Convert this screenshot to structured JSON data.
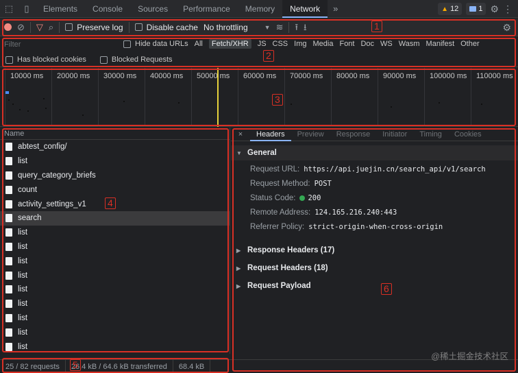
{
  "tabs": {
    "items": [
      {
        "label": "Elements"
      },
      {
        "label": "Console"
      },
      {
        "label": "Sources"
      },
      {
        "label": "Performance"
      },
      {
        "label": "Memory"
      },
      {
        "label": "Network"
      }
    ],
    "more": "»",
    "warnings_count": "12",
    "messages_count": "1"
  },
  "toolbar": {
    "preserve_log": "Preserve log",
    "disable_cache": "Disable cache",
    "throttling": "No throttling"
  },
  "filter": {
    "placeholder": "Filter",
    "hide_data_urls": "Hide data URLs",
    "types": [
      "All",
      "Fetch/XHR",
      "JS",
      "CSS",
      "Img",
      "Media",
      "Font",
      "Doc",
      "WS",
      "Wasm",
      "Manifest",
      "Other"
    ],
    "active_type": "Fetch/XHR",
    "has_blocked_cookies": "Has blocked cookies",
    "blocked_requests": "Blocked Requests"
  },
  "overview": {
    "ticks": [
      "10000 ms",
      "20000 ms",
      "30000 ms",
      "40000 ms",
      "50000 ms",
      "60000 ms",
      "70000 ms",
      "80000 ms",
      "90000 ms",
      "100000 ms",
      "110000 ms"
    ]
  },
  "requests": {
    "header": "Name",
    "items": [
      "abtest_config/",
      "list",
      "query_category_briefs",
      "count",
      "activity_settings_v1",
      "search",
      "list",
      "list",
      "list",
      "list",
      "list",
      "list",
      "list",
      "list",
      "list"
    ],
    "selected_index": 5
  },
  "details": {
    "close": "×",
    "tabs": [
      "Headers",
      "Preview",
      "Response",
      "Initiator",
      "Timing",
      "Cookies"
    ],
    "active_tab": "Headers",
    "general_title": "General",
    "request_url_key": "Request URL:",
    "request_url_value": "https://api.juejin.cn/search_api/v1/search",
    "request_method_key": "Request Method:",
    "request_method_value": "POST",
    "status_code_key": "Status Code:",
    "status_code_value": "200",
    "remote_address_key": "Remote Address:",
    "remote_address_value": "124.165.216.240:443",
    "referrer_policy_key": "Referrer Policy:",
    "referrer_policy_value": "strict-origin-when-cross-origin",
    "response_headers": "Response Headers (17)",
    "request_headers": "Request Headers (18)",
    "request_payload": "Request Payload"
  },
  "status": {
    "requests": "25 / 82 requests",
    "transferred": "26.4 kB / 64.6 kB transferred",
    "resources": "68.4 kB"
  },
  "annotations": [
    "1",
    "2",
    "3",
    "4",
    "5",
    "6"
  ],
  "watermark": "@稀土掘金技术社区",
  "colors": {
    "annotation_red": "#d93025",
    "record_red": "#f28b82",
    "status_green": "#34a853",
    "tab_accent": "#8ab4f8",
    "timeline_marker": "#e5d13b"
  }
}
